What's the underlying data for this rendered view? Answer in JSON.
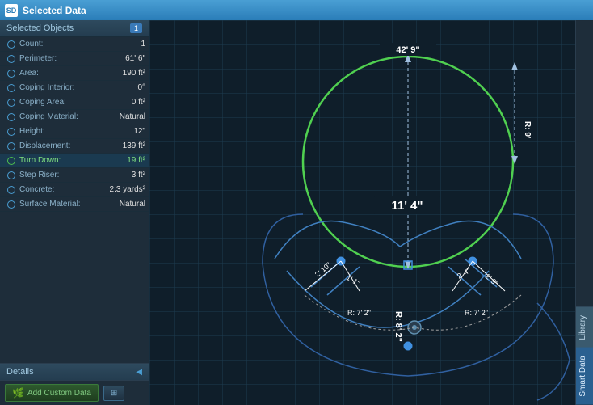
{
  "header": {
    "title": "Selected Data",
    "icon": "SD"
  },
  "panel": {
    "section_title": "Selected Objects",
    "badge": "1",
    "rows": [
      {
        "label": "Count:",
        "value": "1",
        "icon_type": "circle",
        "highlight": false
      },
      {
        "label": "Perimeter:",
        "value": "61' 6\"",
        "icon_type": "circle",
        "highlight": false
      },
      {
        "label": "Area:",
        "value": "190 ft²",
        "icon_type": "circle",
        "highlight": false
      },
      {
        "label": "Coping Interior:",
        "value": "0°",
        "icon_type": "circle",
        "highlight": false
      },
      {
        "label": "Coping Area:",
        "value": "0 ft²",
        "icon_type": "circle",
        "highlight": false
      },
      {
        "label": "Coping Material:",
        "value": "Natural",
        "icon_type": "circle",
        "highlight": false
      },
      {
        "label": "Height:",
        "value": "12\"",
        "icon_type": "circle",
        "highlight": false
      },
      {
        "label": "Displacement:",
        "value": "139 ft²",
        "icon_type": "circle",
        "highlight": false
      },
      {
        "label": "Turn Down:",
        "value": "19 ft²",
        "icon_type": "circle-green",
        "highlight": true
      },
      {
        "label": "Step Riser:",
        "value": "3 ft²",
        "icon_type": "circle",
        "highlight": false
      },
      {
        "label": "Concrete:",
        "value": "2.3 yards²",
        "icon_type": "circle",
        "highlight": false
      },
      {
        "label": "Surface Material:",
        "value": "Natural",
        "icon_type": "circle",
        "highlight": false
      }
    ],
    "details_title": "Details",
    "add_custom_label": "Add Custom Data",
    "calc_icon": "≡"
  },
  "tabs": {
    "library": "Library",
    "smart_data": "Smart Data"
  },
  "canvas": {
    "dim_center": "11' 4\"",
    "dim_top": "42' 9\"",
    "dim_right": "R: 9'"
  }
}
